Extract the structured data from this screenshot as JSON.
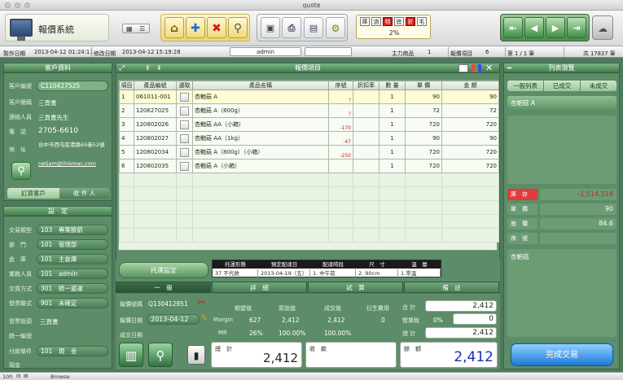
{
  "window": {
    "title": "quote"
  },
  "app": {
    "name": "報價系統"
  },
  "toolbar": {
    "status_chips": [
      "庫",
      "過",
      "特",
      "底",
      "折",
      "毛"
    ],
    "status_red": [
      false,
      false,
      true,
      false,
      true,
      false
    ],
    "percent": "2%"
  },
  "info": {
    "created_label": "製作日期",
    "created_date": "2013-04-12",
    "created_time": "01:24:11",
    "modified_label": "修改日期",
    "modified_date": "2013-04-12",
    "modified_time": "15:19:28",
    "user": "admin",
    "main_product_label": "主力商品",
    "main_product_value": "1",
    "quote_items_label": "報價項目",
    "quote_items_value": "6",
    "record": "第 1 / 1 筆",
    "total": "共 17837 筆"
  },
  "customer": {
    "header": "客戶資料",
    "code_label": "客戶編號",
    "code": "C110427525",
    "short_label": "客戶簡稱",
    "short": "三頁書",
    "contact_label": "連絡人員",
    "contact": "三頁書先生",
    "phone_label": "電　話",
    "phone": "2705-6610",
    "address_label": "地　址",
    "address": "台中市西屯區港路65巷52號",
    "email": "netjam@thismac.com",
    "tab_order": "訂貨客戶",
    "tab_recv": "收 件 人"
  },
  "settings": {
    "header": "設　定",
    "items": [
      {
        "label": "交易類型",
        "code": "103",
        "value": "專案臉箭"
      },
      {
        "label": "部　門",
        "code": "101",
        "value": "管理部"
      },
      {
        "label": "倉　庫",
        "code": "101",
        "value": "主倉庫"
      },
      {
        "label": "業務人員",
        "code": "101",
        "value": "admin"
      },
      {
        "label": "交貨方式",
        "code": "301",
        "value": "統一遞運"
      },
      {
        "label": "發票聯式",
        "code": "901",
        "value": "未確定"
      }
    ],
    "invoice_title_label": "發票抬頭",
    "invoice_title": "三頁書",
    "tax_id_label": "統一編號",
    "pay_label": "付款條件",
    "pay_code": "101",
    "pay_value": "現　金",
    "cash_label": "現金"
  },
  "items_panel": {
    "header": "報價項目",
    "columns": [
      "項目",
      "產品編號",
      "選取",
      "產品名稱",
      "序號",
      "折扣率",
      "數 量",
      "單 價",
      "金 額"
    ],
    "rows": [
      {
        "no": "1",
        "code": "061011-001",
        "name": "杏鮑菇 A",
        "serial": "?",
        "qty": "1",
        "price": "90",
        "amount": "90"
      },
      {
        "no": "2",
        "code": "120627025",
        "name": "杏鮑菇 A（800g）",
        "serial": "?",
        "qty": "1",
        "price": "72",
        "amount": "72"
      },
      {
        "no": "3",
        "code": "120802026",
        "name": "杏鮑菇 AA（小箱）",
        "serial": "-170",
        "qty": "1",
        "price": "720",
        "amount": "720"
      },
      {
        "no": "4",
        "code": "120802027",
        "name": "杏鮑菇 AA（1kg）",
        "serial": "-47",
        "qty": "1",
        "price": "90",
        "amount": "90"
      },
      {
        "no": "5",
        "code": "120802034",
        "name": "杏鮑菇 A（800g）（小箱）",
        "serial": "-250",
        "qty": "1",
        "price": "720",
        "amount": "720"
      },
      {
        "no": "6",
        "code": "120802035",
        "name": "杏鮑菇 A（小箱）",
        "serial": "",
        "qty": "1",
        "price": "720",
        "amount": "720"
      }
    ]
  },
  "shipping": {
    "button": "托運設定",
    "headers": [
      "托運形態",
      "預定配達日",
      "配達時段",
      "尺　寸",
      "溫　層"
    ],
    "values": [
      "37 不代收",
      "2013-04-19（五）",
      "1. 中午前",
      "2. 90cm",
      "1.常溫"
    ]
  },
  "bottom_tabs": [
    "一　般",
    "詳　細",
    "試　算",
    "備　註"
  ],
  "general": {
    "quote_no_label": "報價號碼",
    "quote_no": "Q130412851",
    "quote_date_label": "報價日期",
    "quote_date": "2013-04-12",
    "deal_date_label": "成交日期"
  },
  "calc": {
    "headers": [
      "期望值",
      "原始值",
      "成交值",
      "衍生費用"
    ],
    "margin_label": "Margin",
    "margin_expected": "627",
    "margin_original": "2,412",
    "margin_deal": "2,412",
    "derived": "0",
    "mr_label": "MR",
    "mr_expected": "26%",
    "mr_original": "100.00%",
    "mr_deal": "100.00%"
  },
  "summary": {
    "subtotal_label": "合 計",
    "subtotal": "2,412",
    "tax_label": "營業稅",
    "tax_rate": "0%",
    "tax": "0",
    "total_label": "總 計",
    "total": "2,412"
  },
  "totals": {
    "total_label": "總　計",
    "total": "2,412",
    "received_label": "收　款",
    "received": "",
    "balance_label": "餘　額",
    "balance": "2,412"
  },
  "right": {
    "header": "列表瀏覽",
    "tabs": [
      "一般列表",
      "已成交",
      "未成交"
    ],
    "list_item": "杏鮑菇 A",
    "stock_label": "庫　存",
    "stock": "-1,514,518",
    "price_label": "單　價",
    "price": "90",
    "cost_label": "底　價",
    "cost": "84.6",
    "serial_label": "序　號",
    "serial": "",
    "note": "杏鮑菇",
    "complete_button": "完成交易"
  },
  "statusbar": {
    "zoom": "100",
    "mode": "Browse"
  },
  "colors": {
    "panel": "#5c8d68",
    "accent_blue": "#1c2fb0",
    "negative_red": "#cc2020",
    "highlight_row": "#fffbd4"
  }
}
